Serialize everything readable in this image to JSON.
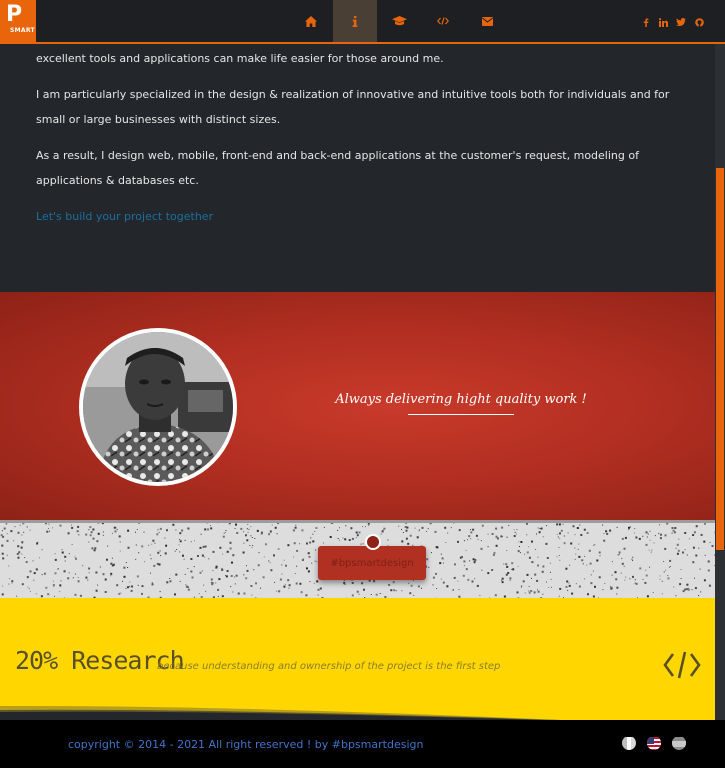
{
  "navbar": {
    "logo_mark": "P",
    "logo_text": "SMART",
    "items": [
      {
        "icon": "home-icon"
      },
      {
        "icon": "info-icon",
        "label": "i",
        "active": true
      },
      {
        "icon": "graduation-cap-icon"
      },
      {
        "icon": "code-icon"
      },
      {
        "icon": "envelope-icon"
      }
    ],
    "social": [
      {
        "icon": "facebook-icon",
        "glyph": "f"
      },
      {
        "icon": "linkedin-icon",
        "glyph": "in"
      },
      {
        "icon": "twitter-icon"
      },
      {
        "icon": "github-icon"
      }
    ],
    "accent_color": "#e8650b"
  },
  "about": {
    "p1": "excellent tools and applications can make life easier for those around me.",
    "p2": "I am particularly specialized in the design & realization of innovative and intuitive tools both for individuals and for small or large businesses with distinct sizes.",
    "p3": "As a result, I design web, mobile, front-end and back-end applications at the customer's request, modeling of applications & databases etc.",
    "link": "Let's build your project together"
  },
  "banner": {
    "tagline": "Always delivering hight quality work !",
    "color": "#b22f22"
  },
  "strip": {
    "hashtag": "#bpsmartdesign"
  },
  "research": {
    "title": "20% Research",
    "subtitle": "because understanding and ownership of the project is the first step",
    "background": "#ffd600"
  },
  "footer": {
    "copyright": "copyright © 2014 - 2021 All right reserved ! by #bpsmartdesign",
    "flags": [
      {
        "icon": "italy-flag-icon"
      },
      {
        "icon": "usa-flag-icon"
      },
      {
        "icon": "spain-flag-icon"
      }
    ]
  }
}
